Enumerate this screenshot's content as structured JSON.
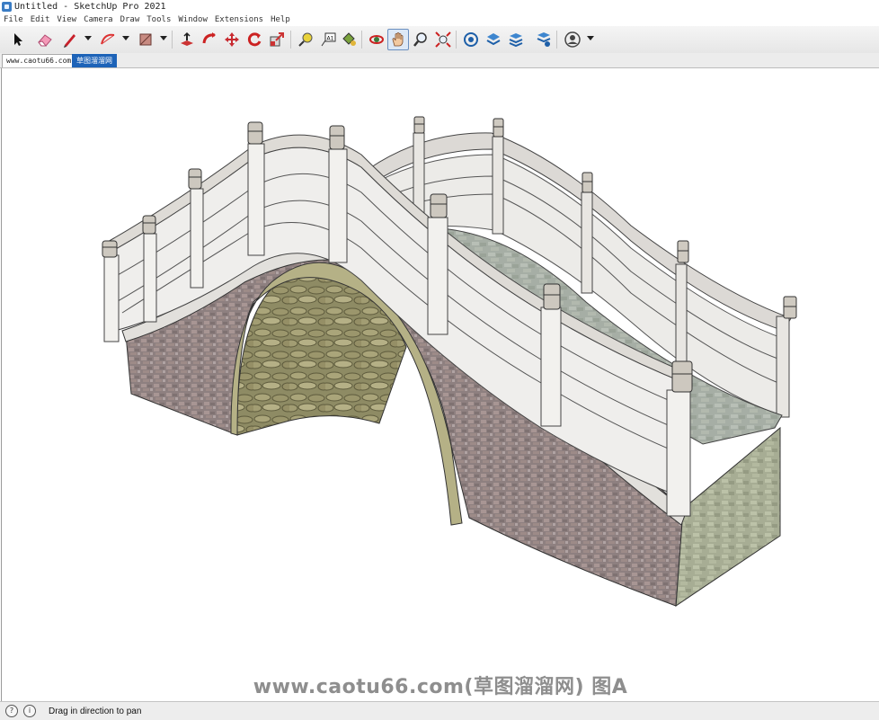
{
  "window": {
    "title": "Untitled - SketchUp Pro 2021"
  },
  "menu": {
    "items": [
      "File",
      "Edit",
      "View",
      "Camera",
      "Draw",
      "Tools",
      "Window",
      "Extensions",
      "Help"
    ]
  },
  "toolbar": {
    "tools": [
      {
        "icon": "select-arrow-icon"
      },
      {
        "icon": "eraser-icon"
      },
      {
        "icon": "pencil-line-icon",
        "dropdown": true
      },
      {
        "icon": "arc-icon",
        "dropdown": true
      },
      {
        "icon": "rectangle-icon",
        "dropdown": true
      },
      {
        "icon": "push-pull-icon"
      },
      {
        "icon": "follow-me-icon"
      },
      {
        "icon": "move-icon"
      },
      {
        "icon": "rotate-icon"
      },
      {
        "icon": "scale-icon"
      },
      {
        "icon": "tape-measure-icon"
      },
      {
        "icon": "text-label-icon"
      },
      {
        "icon": "paint-bucket-icon"
      },
      {
        "icon": "orbit-icon"
      },
      {
        "icon": "pan-hand-icon",
        "active": true
      },
      {
        "icon": "zoom-icon"
      },
      {
        "icon": "zoom-extents-icon"
      },
      {
        "icon": "3d-warehouse-icon"
      },
      {
        "icon": "extension-warehouse-icon"
      },
      {
        "icon": "layer-manager-icon"
      },
      {
        "icon": "extension-manager-icon"
      },
      {
        "icon": "account-icon",
        "dropdown": true
      }
    ],
    "accent": "#1d63b8"
  },
  "tabs": [
    {
      "label": "www.caotu66.com"
    },
    {
      "label": "草图溜溜网",
      "active": true
    }
  ],
  "viewport": {
    "watermark": "www.caotu66.com(草图溜溜网) 图A"
  },
  "status": {
    "text": "Drag in direction to pan"
  }
}
